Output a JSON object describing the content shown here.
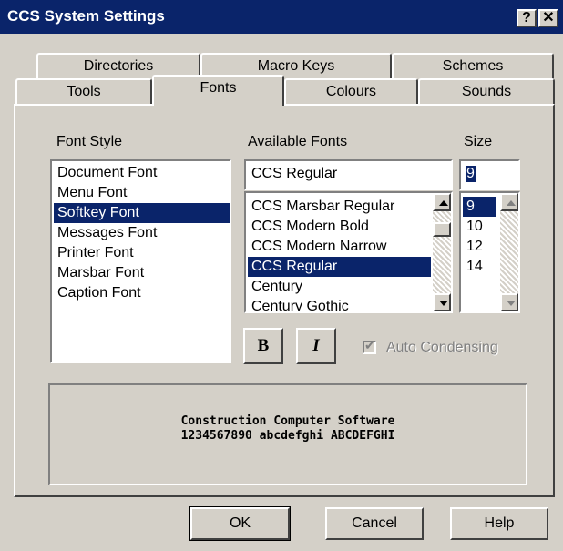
{
  "window": {
    "title": "CCS System Settings",
    "help_btn": "?",
    "close_btn": "✕"
  },
  "tabs": {
    "row1": [
      "Directories",
      "Macro Keys",
      "Schemes"
    ],
    "row2": [
      "Tools",
      "Fonts",
      "Colours",
      "Sounds"
    ],
    "active": "Fonts"
  },
  "font_style": {
    "label": "Font Style",
    "items": [
      "Document Font",
      "Menu Font",
      "Softkey Font",
      "Messages Font",
      "Printer Font",
      "Marsbar Font",
      "Caption Font"
    ],
    "selected": "Softkey Font"
  },
  "available_fonts": {
    "label": "Available Fonts",
    "value": "CCS Regular",
    "items": [
      "CCS Marsbar Regular",
      "CCS Modern Bold",
      "CCS Modern Narrow",
      "CCS Regular",
      "Century",
      "Century Gothic"
    ],
    "selected": "CCS Regular"
  },
  "size": {
    "label": "Size",
    "value": "9",
    "items": [
      "9",
      "10",
      "12",
      "14"
    ],
    "selected": "9"
  },
  "style_buttons": {
    "bold": "B",
    "italic": "I"
  },
  "auto_condensing": {
    "label": "Auto Condensing",
    "checked": true,
    "enabled": false
  },
  "preview": {
    "line1": "Construction Computer Software",
    "line2": "1234567890 abcdefghi ABCDEFGHI"
  },
  "buttons": {
    "ok": "OK",
    "cancel": "Cancel",
    "help": "Help"
  },
  "colors": {
    "titlebar": "#0a246a",
    "face": "#d4d0c8",
    "selection": "#0a246a"
  }
}
